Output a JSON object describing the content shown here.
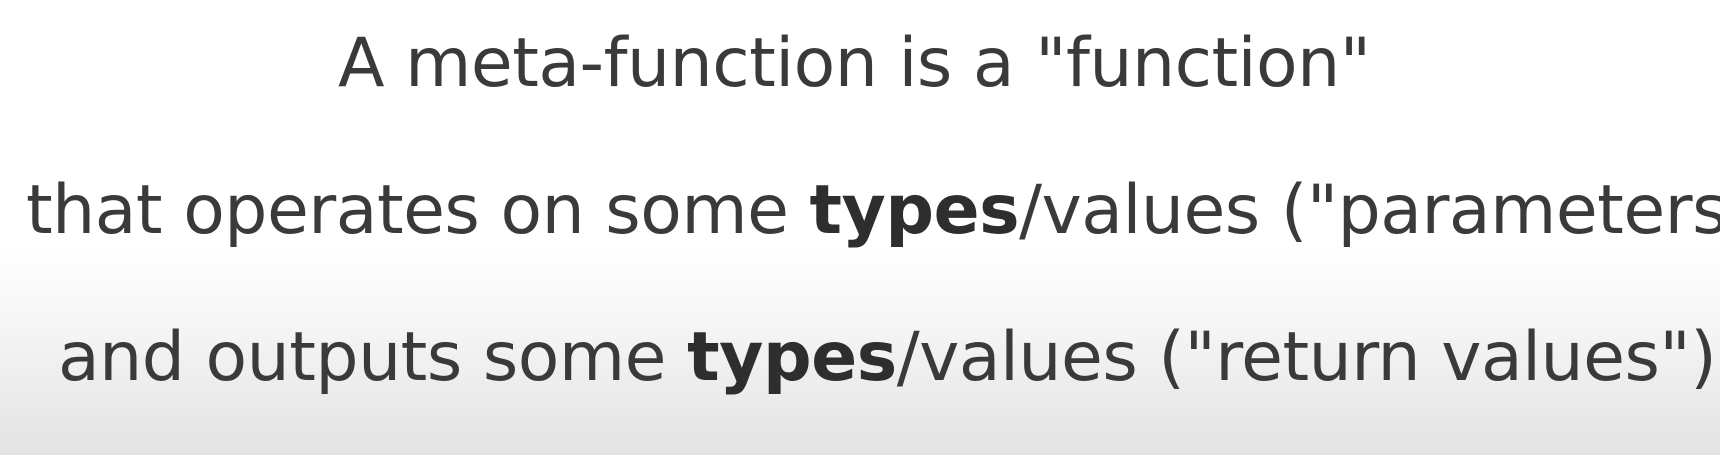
{
  "slide": {
    "line1": {
      "text": "A meta-function is a \"function\""
    },
    "line2": {
      "pre": "that operates on some ",
      "bold": "types",
      "post": "/values (\"parameters\")"
    },
    "line3": {
      "pre": "and outputs some ",
      "bold": "types",
      "post": "/values (\"return values\")."
    }
  }
}
